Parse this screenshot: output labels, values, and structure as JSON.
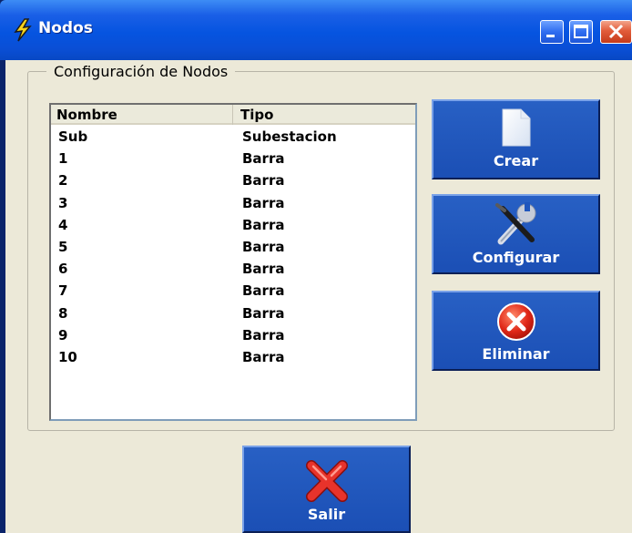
{
  "window": {
    "title": "Nodos",
    "icons": {
      "app": "lightning-bolt-icon",
      "minimize": "minimize-icon",
      "maximize": "maximize-icon",
      "close": "close-icon"
    }
  },
  "group": {
    "label": "Configuración de Nodos"
  },
  "list": {
    "columns": [
      "Nombre",
      "Tipo"
    ],
    "rows": [
      {
        "name": "Sub",
        "type": "Subestacion"
      },
      {
        "name": "1",
        "type": "Barra"
      },
      {
        "name": "2",
        "type": "Barra"
      },
      {
        "name": "3",
        "type": "Barra"
      },
      {
        "name": "4",
        "type": "Barra"
      },
      {
        "name": "5",
        "type": "Barra"
      },
      {
        "name": "6",
        "type": "Barra"
      },
      {
        "name": "7",
        "type": "Barra"
      },
      {
        "name": "8",
        "type": "Barra"
      },
      {
        "name": "9",
        "type": "Barra"
      },
      {
        "name": "10",
        "type": "Barra"
      }
    ]
  },
  "buttons": {
    "crear": {
      "label": "Crear",
      "icon": "document-icon"
    },
    "configurar": {
      "label": "Configurar",
      "icon": "tools-icon"
    },
    "eliminar": {
      "label": "Eliminar",
      "icon": "error-x-icon"
    },
    "salir": {
      "label": "Salir",
      "icon": "red-x-icon"
    }
  },
  "colors": {
    "titlebar": "#0554e0",
    "button": "#1f56bd",
    "client_bg": "#ece9d8"
  }
}
